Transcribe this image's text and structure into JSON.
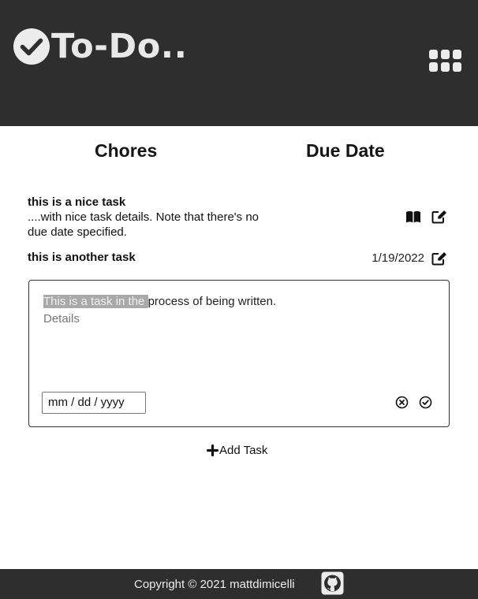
{
  "header": {
    "title": "To-Do..",
    "logo_icon": "check-circle-icon",
    "menu_icon": "grid-menu-icon",
    "background": "#2e2e2e"
  },
  "columns": {
    "chores": "Chores",
    "due_date": "Due Date"
  },
  "tasks": [
    {
      "title": "this is a nice task",
      "details": "....with nice task details. Note that there's no due date specified.",
      "due": "",
      "icons": [
        "book-open-icon",
        "edit-icon"
      ]
    },
    {
      "title": "this is another task",
      "details": "",
      "due": "1/19/2022",
      "icons": [
        "edit-icon"
      ]
    }
  ],
  "editor": {
    "title_selected": "This is a task in the ",
    "title_rest": "process of being written.",
    "details_placeholder": "Details",
    "date_placeholder": "mm / dd / yyyy",
    "cancel_icon": "close-circle-icon",
    "confirm_icon": "check-circle-icon"
  },
  "add_task": {
    "label": "Add Task",
    "icon": "plus-icon"
  },
  "footer": {
    "copyright": "Copyright © 2021 mattdimicelli",
    "github_icon": "github-icon"
  }
}
